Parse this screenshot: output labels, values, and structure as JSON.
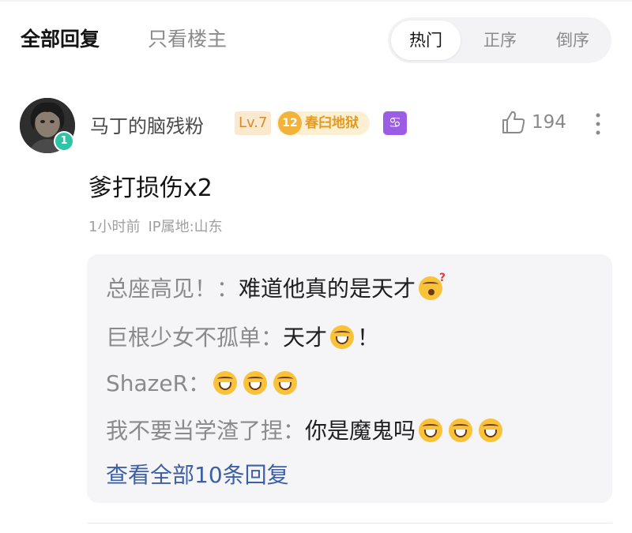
{
  "tabs": {
    "all_replies": "全部回复",
    "only_op": "只看楼主"
  },
  "sort": {
    "hot": "热门",
    "ascending": "正序",
    "descending": "倒序",
    "active": "hot"
  },
  "comment": {
    "avatar_badge": "1",
    "username": "马丁的脑残粉",
    "level": "Lv.7",
    "title_level": "12",
    "title_name": "春臼地狱",
    "zodiac_symbol": "♋",
    "zodiac_icon": "cancer-zodiac-icon",
    "likes": "194",
    "text": "爹打损伤x2",
    "time": "1小时前",
    "ip_location": "IP属地:山东"
  },
  "replies": [
    {
      "name": "总座高见！：",
      "text": "难道他真的是天才",
      "emojis": [
        "thinking-emoji"
      ]
    },
    {
      "name": "巨根少女不孤单：",
      "text": "天才",
      "emojis": [
        "laughing-emoji"
      ],
      "suffix": "！"
    },
    {
      "name": "ShazeR：",
      "text": "",
      "emojis": [
        "grinning-emoji",
        "grinning-emoji",
        "grinning-emoji"
      ]
    },
    {
      "name": "我不要当学渣了捏：",
      "text": "你是魔鬼吗",
      "emojis": [
        "laughing-emoji",
        "laughing-emoji",
        "laughing-emoji"
      ]
    }
  ],
  "view_all": "查看全部10条回复",
  "colors": {
    "accent_link": "#3d5fa6",
    "level_badge": "#d98a2a",
    "title_badge": "#e39a1f",
    "zodiac": "#9b5de5",
    "avatar_badge": "#2ec4a6"
  }
}
